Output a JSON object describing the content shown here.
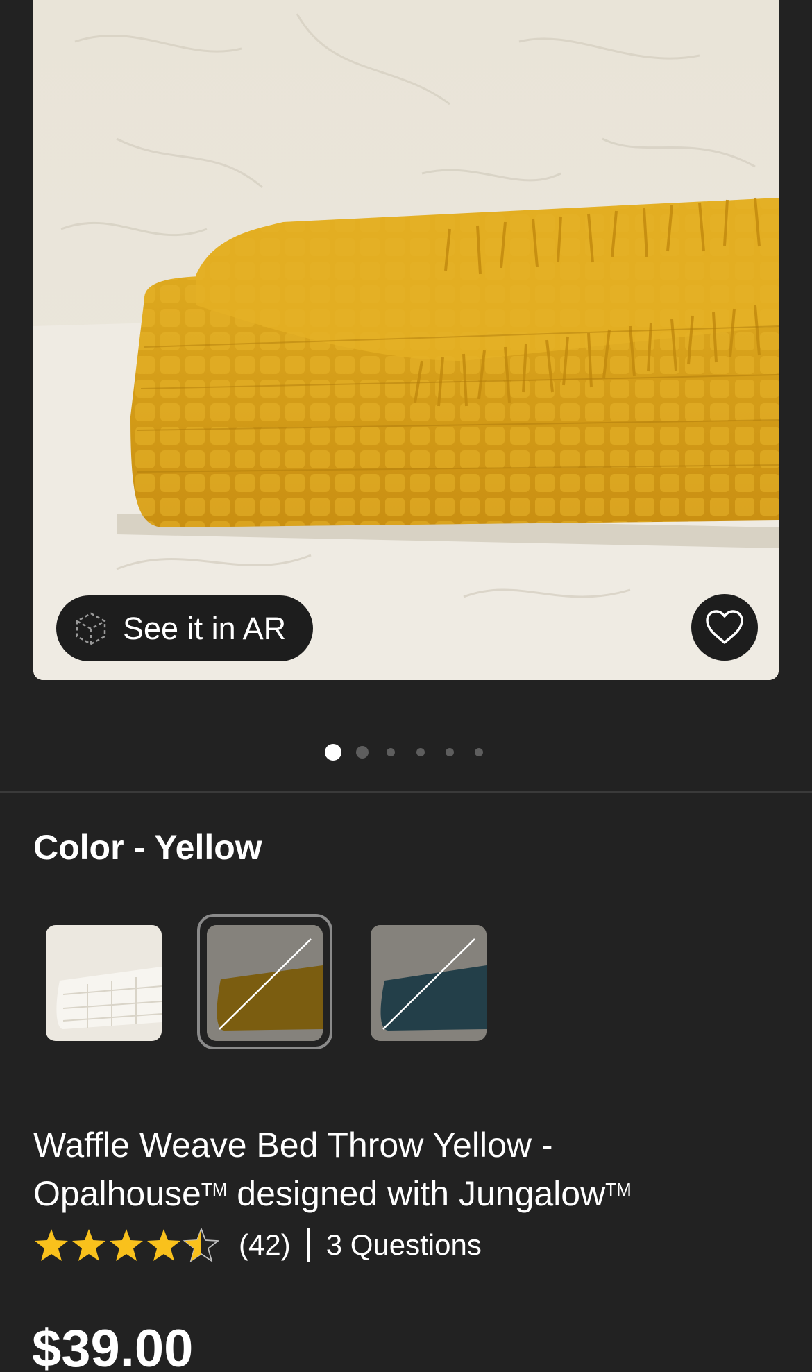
{
  "hero": {
    "ar_button_label": "See it in AR",
    "ar_icon": "ar-cube-icon",
    "favorite_icon": "heart-icon",
    "carousel": {
      "count": 6,
      "active": 0
    }
  },
  "color": {
    "title": "Color - Yellow",
    "swatches": [
      {
        "name": "Cream",
        "available": true,
        "selected": false
      },
      {
        "name": "Yellow",
        "available": false,
        "selected": true
      },
      {
        "name": "Blue",
        "available": false,
        "selected": false
      }
    ]
  },
  "product": {
    "title_part1": "Waffle Weave Bed Throw Yellow -",
    "brand1": "Opalhouse",
    "tm": "TM",
    "designed_with": " designed with ",
    "brand2": "Jungalow",
    "rating": 4.5,
    "review_count": "(42)",
    "questions": "3 Questions",
    "price": "$39.00"
  },
  "colors": {
    "background": "#222222",
    "star": "#f9c11c",
    "throw_yellow": "#d9a21a"
  }
}
